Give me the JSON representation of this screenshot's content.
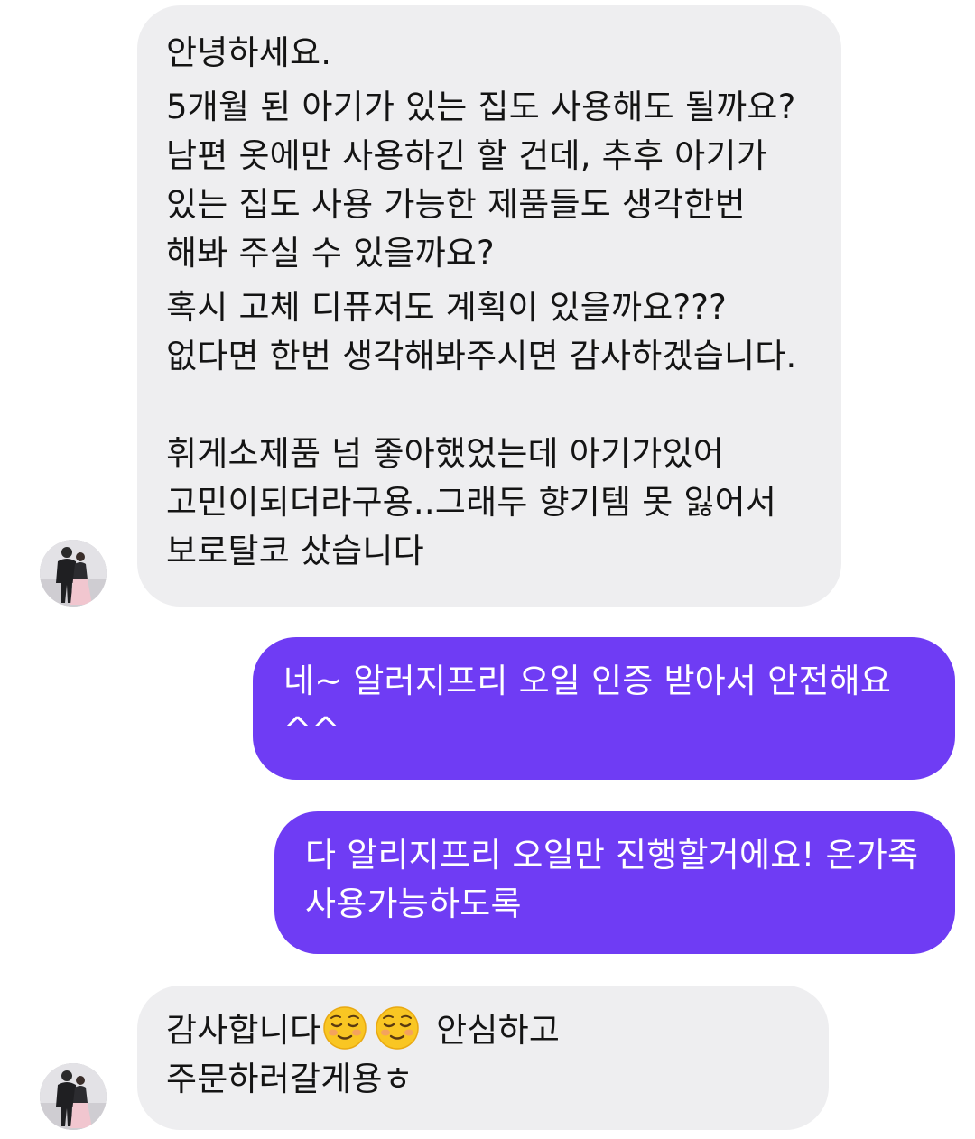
{
  "messages": [
    {
      "direction": "incoming",
      "paragraphs": [
        "안녕하세요.",
        "5개월 된 아기가 있는 집도 사용해도 될까요? 남편 옷에만 사용하긴 할 건데, 추후 아기가 있는 집도 사용 가능한 제품들도 생각한번 해봐 주실 수 있을까요?",
        "혹시 고체 디퓨저도 계획이 있을까요??? 없다면 한번 생각해봐주시면 감사하겠습니다.",
        "휘게소제품 넘 좋아했었는데 아기가있어 고민이되더라구용..그래두 향기템 못 잃어서 보로탈코 샀습니다"
      ]
    },
    {
      "direction": "outgoing",
      "text": "네~ 알러지프리 오일 인증 받아서 안전해요 ^^"
    },
    {
      "direction": "outgoing",
      "text": "다 알리지프리 오일만 진행할거에요! 온가족 사용가능하도록"
    },
    {
      "direction": "incoming",
      "text_before_emoji": "감사합니다",
      "emoji": [
        "smiling-face-icon",
        "smiling-face-icon"
      ],
      "text_after_emoji": " 안심하고 주문하러갈게용ㅎ"
    }
  ],
  "colors": {
    "incoming_bubble": "#eeeef0",
    "incoming_text": "#141414",
    "outgoing_bubble": "#6f3cf4",
    "outgoing_text": "#ffffff"
  },
  "avatar": {
    "icon": "user-avatar-icon"
  }
}
